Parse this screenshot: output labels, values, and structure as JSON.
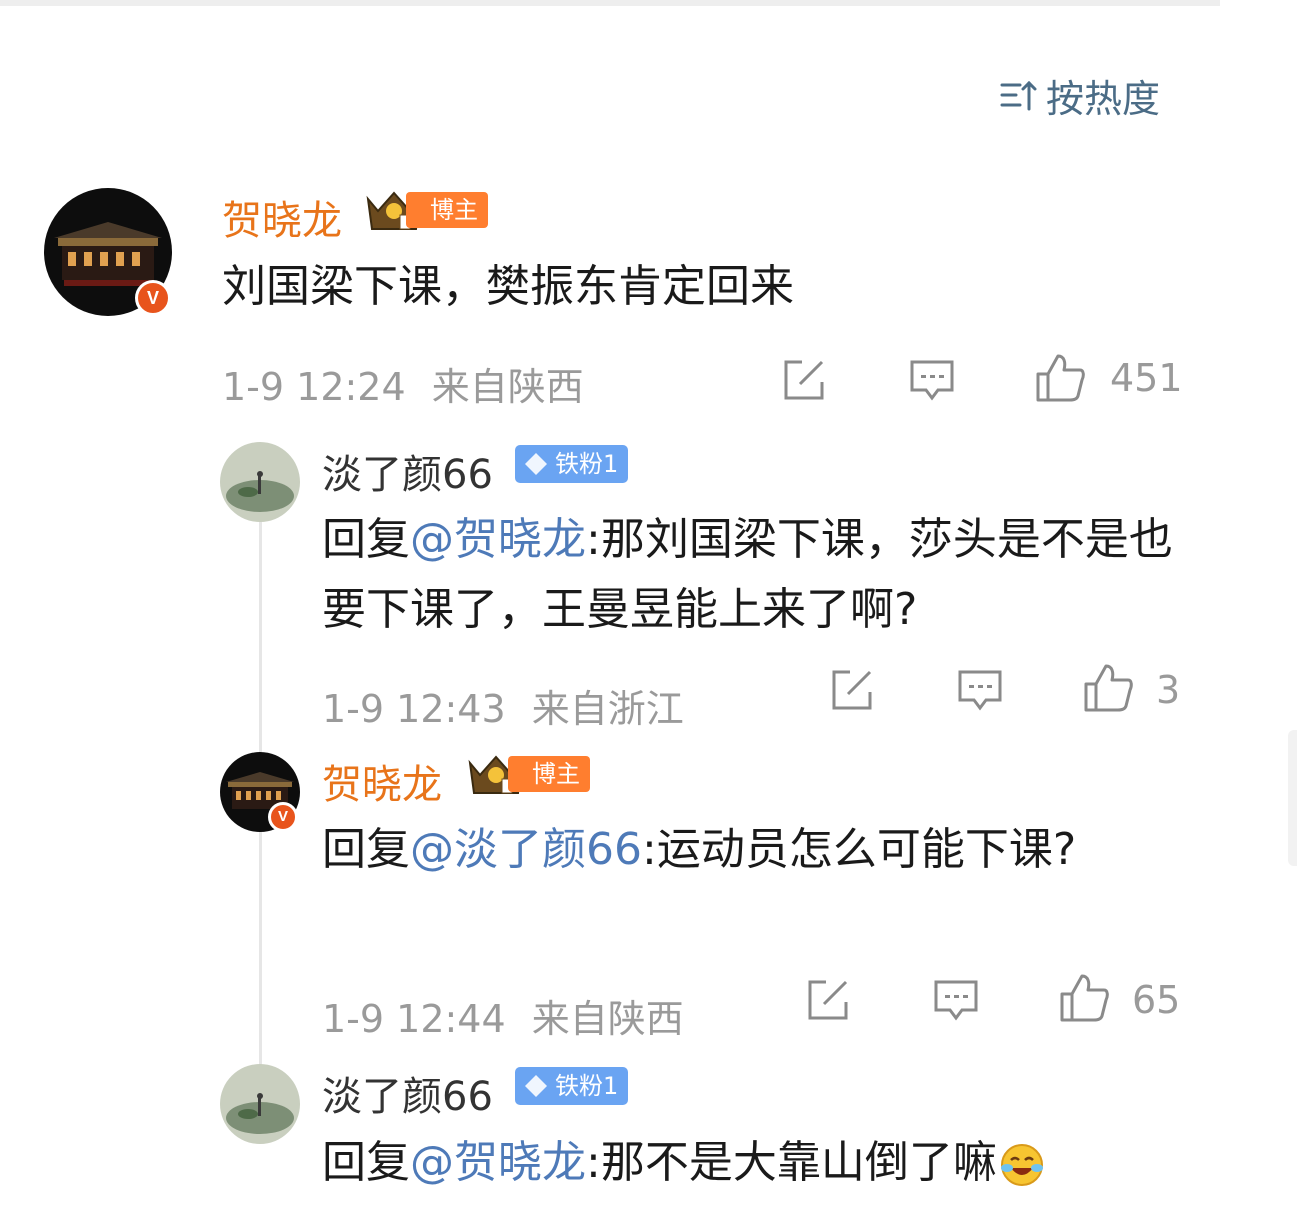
{
  "sort": {
    "label": "按热度",
    "icon": "sort-hot-icon"
  },
  "comments": [
    {
      "name": "贺晓龙",
      "badge": "博主",
      "text": "刘国梁下课，樊振东肯定回来",
      "time": "1-9 12:24",
      "location": "来自陕西",
      "likes": "451"
    },
    {
      "name": "淡了颜66",
      "badge": "铁粉1",
      "reply_prefix": "回复",
      "mention": "@贺晓龙",
      "text": ":那刘国梁下课，莎头是不是也要下课了，王曼昱能上来了啊?",
      "time": "1-9 12:43",
      "location": "来自浙江",
      "likes": "3"
    },
    {
      "name": "贺晓龙",
      "badge": "博主",
      "reply_prefix": "回复",
      "mention": "@淡了颜66",
      "text": ":运动员怎么可能下课?",
      "time": "1-9 12:44",
      "location": "来自陕西",
      "likes": "65"
    },
    {
      "name": "淡了颜66",
      "badge": "铁粉1",
      "reply_prefix": "回复",
      "mention": "@贺晓龙",
      "text": ":那不是大靠山倒了嘛",
      "emoji": "laughing-crying-emoji"
    }
  ],
  "colors": {
    "author_name": "#e8741a",
    "mention": "#4e7ab8",
    "meta": "#9a9a9a",
    "author_badge": "#ff7e2f",
    "fan_badge": "#6aa4f2"
  }
}
